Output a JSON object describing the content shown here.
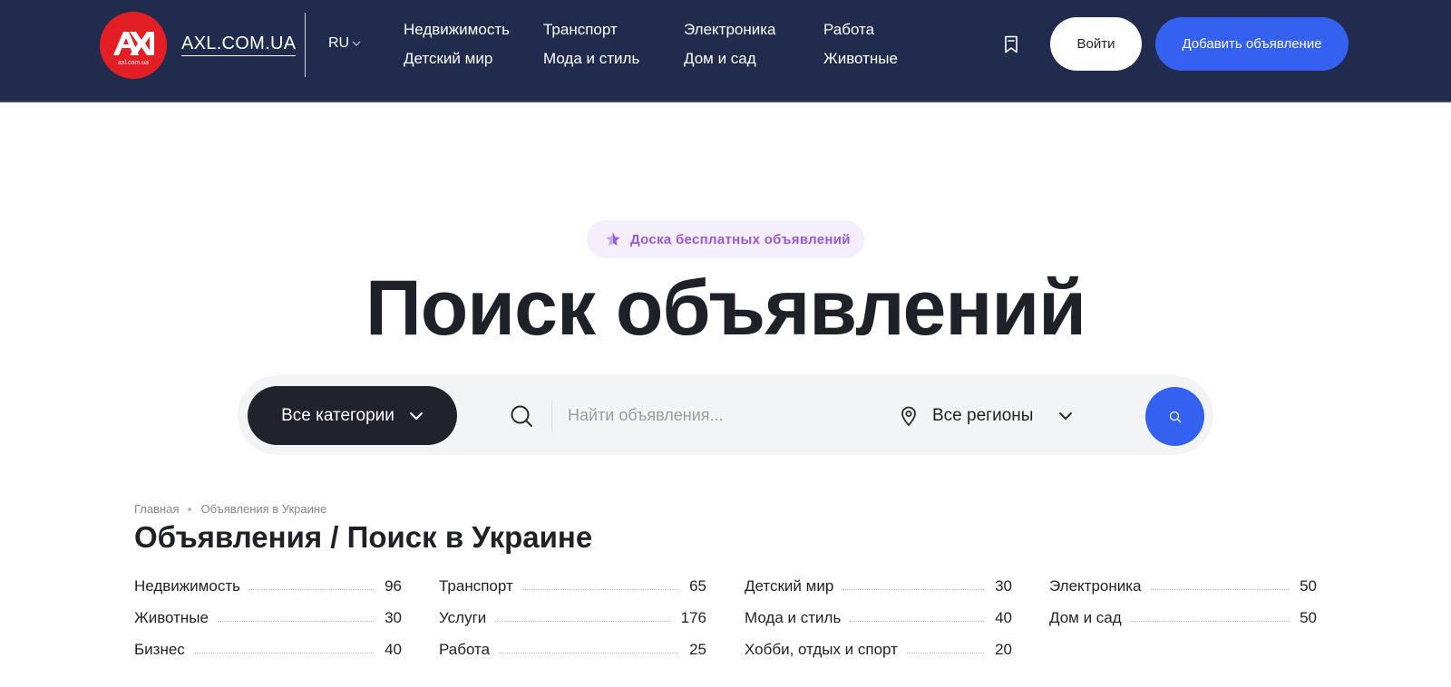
{
  "header": {
    "logo_text": "axl.com.ua",
    "site_name": "AXL.COM.UA",
    "language": "RU",
    "nav": [
      "Недвижимость",
      "Детский мир",
      "Транспорт",
      "Мода и стиль",
      "Электроника",
      "Дом и сад",
      "Работа",
      "Животные"
    ],
    "login_label": "Войти",
    "add_listing_label": "Добавить объявление"
  },
  "hero": {
    "badge": "Доска бесплатных объявлений",
    "title": "Поиск объявлений"
  },
  "search": {
    "category_label": "Все категории",
    "placeholder": "Найти объявления...",
    "region_label": "Все регионы"
  },
  "breadcrumb": [
    "Главная",
    "Объявления в Украине"
  ],
  "section_title": "Объявления / Поиск в Украине",
  "categories": [
    {
      "name": "Недвижимость",
      "count": "96"
    },
    {
      "name": "Транспорт",
      "count": "65"
    },
    {
      "name": "Детский мир",
      "count": "30"
    },
    {
      "name": "Электроника",
      "count": "50"
    },
    {
      "name": "Животные",
      "count": "30"
    },
    {
      "name": "Услуги",
      "count": "176"
    },
    {
      "name": "Мода и стиль",
      "count": "40"
    },
    {
      "name": "Дом и сад",
      "count": "50"
    },
    {
      "name": "Бизнес",
      "count": "40"
    },
    {
      "name": "Работа",
      "count": "25"
    },
    {
      "name": "Хобби, отдых и спорт",
      "count": "20"
    }
  ],
  "colors": {
    "header_bg": "#212b4d",
    "accent": "#3461f0",
    "logo_red": "#e31e24",
    "badge_bg": "#f4eefd",
    "badge_text": "#9a5ad8"
  }
}
